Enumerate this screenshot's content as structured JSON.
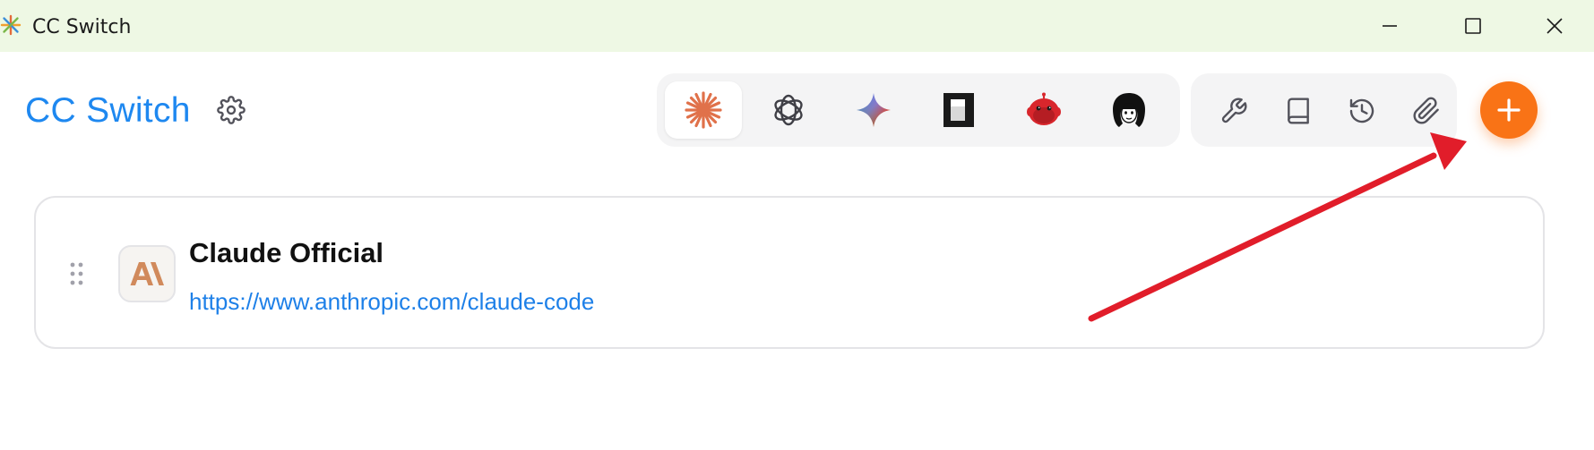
{
  "window": {
    "title": "CC Switch",
    "controls": [
      "minimize",
      "maximize",
      "close"
    ]
  },
  "header": {
    "brand": "CC Switch",
    "settings_icon": "gear-icon"
  },
  "app_switcher": {
    "items": [
      {
        "name": "claude",
        "icon": "claude-starburst-icon",
        "active": true
      },
      {
        "name": "openai",
        "icon": "openai-knot-icon",
        "active": false
      },
      {
        "name": "gemini",
        "icon": "gemini-sparkle-icon",
        "active": false
      },
      {
        "name": "terminal",
        "icon": "terminal-app-icon",
        "active": false
      },
      {
        "name": "red-bot",
        "icon": "red-creature-icon",
        "active": false
      },
      {
        "name": "avatar",
        "icon": "bw-character-icon",
        "active": false
      }
    ]
  },
  "tools": {
    "items": [
      {
        "name": "tools",
        "icon": "wrench-icon"
      },
      {
        "name": "docs",
        "icon": "book-icon"
      },
      {
        "name": "history",
        "icon": "history-icon"
      },
      {
        "name": "attach",
        "icon": "paperclip-icon"
      }
    ]
  },
  "add_button": {
    "icon": "plus-icon",
    "color": "#f97316"
  },
  "providers": [
    {
      "name": "Claude Official",
      "url": "https://www.anthropic.com/claude-code",
      "logo": "anthropic-logo-icon",
      "logo_text": "A\\"
    }
  ],
  "colors": {
    "brand": "#1e88f0",
    "accent": "#f97316",
    "link": "#1e80e8",
    "titlebar": "#eef8e4",
    "annotation": "#e11d2a"
  }
}
